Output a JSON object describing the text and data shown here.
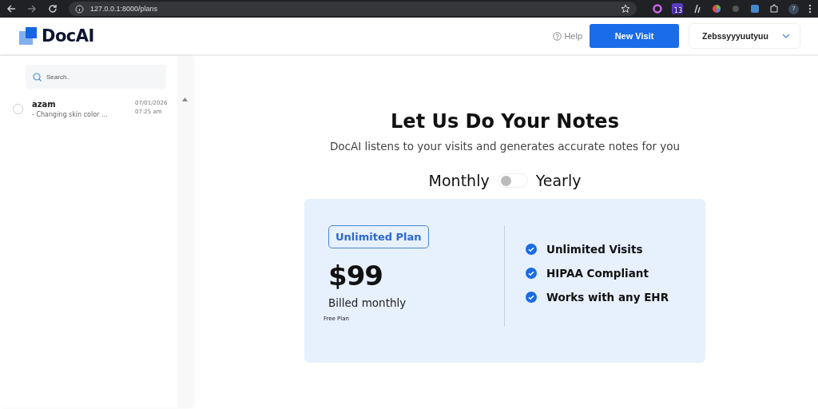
{
  "browser": {
    "url": "127.0.0.1:8000/plans",
    "profile_badge": "7",
    "extension_badge": "13"
  },
  "header": {
    "logo": "DocAI",
    "help": "Help",
    "new_visit": "New Visit",
    "user": "Zebssyyyuutyuu"
  },
  "sidebar": {
    "search": {
      "placeholder": "Search.."
    },
    "items": [
      {
        "name": "azam",
        "snippet": "- Changing skin color ...",
        "date": "07/01/2026",
        "time": "07:25 am",
        "selected": false
      }
    ]
  },
  "main": {
    "title": "Let Us Do Your Notes",
    "subtitle": "DocAI listens to your visits and generates accurate notes for you",
    "billing": {
      "left": "Monthly",
      "right": "Yearly",
      "on": false
    },
    "plan": {
      "badge": "Unlimited Plan",
      "price": "$99",
      "billing": "Billed monthly",
      "note": "Free Plan",
      "features": [
        "Unlimited Visits",
        "HIPAA Compliant",
        "Works with any EHR"
      ]
    }
  }
}
